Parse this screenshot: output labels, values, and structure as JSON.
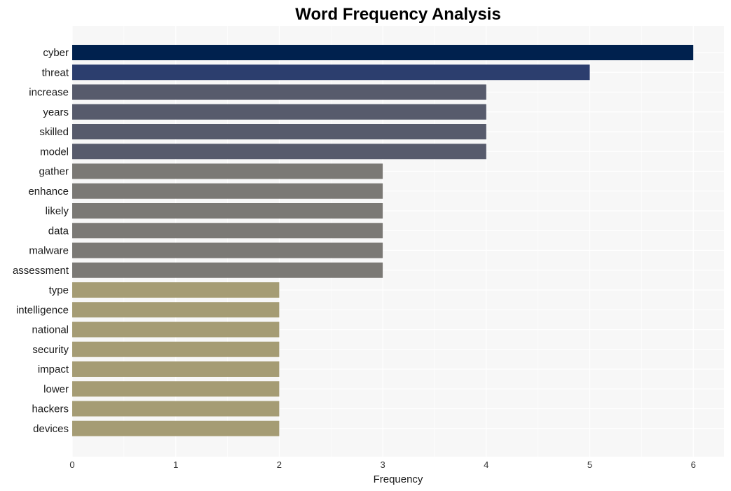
{
  "chart_data": {
    "type": "bar",
    "orientation": "horizontal",
    "title": "Word Frequency Analysis",
    "xlabel": "Frequency",
    "ylabel": "",
    "xlim": [
      0,
      6.3
    ],
    "xticks": [
      0,
      1,
      2,
      3,
      4,
      5,
      6
    ],
    "grid": true,
    "legend": "none",
    "categories": [
      "cyber",
      "threat",
      "increase",
      "years",
      "skilled",
      "model",
      "gather",
      "enhance",
      "likely",
      "data",
      "malware",
      "assessment",
      "type",
      "intelligence",
      "national",
      "security",
      "impact",
      "lower",
      "hackers",
      "devices"
    ],
    "values": [
      6,
      5,
      4,
      4,
      4,
      4,
      3,
      3,
      3,
      3,
      3,
      3,
      2,
      2,
      2,
      2,
      2,
      2,
      2,
      2
    ],
    "colors": {
      "6": "#00214e",
      "5": "#2c3e6e",
      "4": "#575b6c",
      "3": "#7b7975",
      "2": "#a59c74"
    },
    "background": "#f7f7f7"
  }
}
